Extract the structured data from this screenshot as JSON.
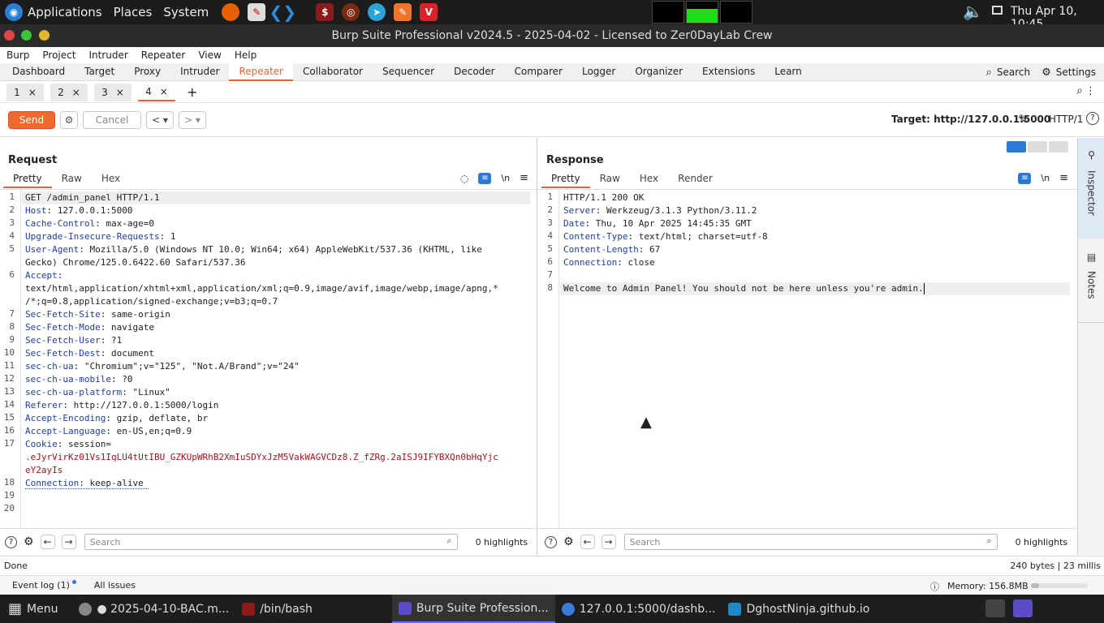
{
  "system": {
    "menus": [
      "Applications",
      "Places",
      "System"
    ],
    "clock": "Thu Apr 10, 10:45"
  },
  "window": {
    "title": "Burp Suite Professional v2024.5 - 2025-04-02 - Licensed to Zer0DayLab Crew"
  },
  "menubar": [
    "Burp",
    "Project",
    "Intruder",
    "Repeater",
    "View",
    "Help"
  ],
  "main_tabs": [
    "Dashboard",
    "Target",
    "Proxy",
    "Intruder",
    "Repeater",
    "Collaborator",
    "Sequencer",
    "Decoder",
    "Comparer",
    "Logger",
    "Organizer",
    "Extensions",
    "Learn"
  ],
  "main_tabs_right": {
    "search": "Search",
    "settings": "Settings"
  },
  "sub_tabs": [
    "1",
    "2",
    "3",
    "4"
  ],
  "toolbar": {
    "send": "Send",
    "cancel": "Cancel",
    "target_label": "Target: http://127.0.0.1:5000",
    "http_version": "HTTP/1"
  },
  "request": {
    "title": "Request",
    "tabs": [
      "Pretty",
      "Raw",
      "Hex"
    ],
    "line_numbers": [
      "1",
      "2",
      "3",
      "4",
      "5",
      "6",
      "7",
      "8",
      "9",
      "10",
      "11",
      "12",
      "13",
      "14",
      "15",
      "16",
      "17",
      "18",
      "19",
      "20"
    ],
    "lines": [
      {
        "key": "",
        "val": "GET /admin_panel HTTP/1.1"
      },
      {
        "key": "Host",
        "val": ": 127.0.0.1:5000"
      },
      {
        "key": "Cache-Control",
        "val": ": max-age=0"
      },
      {
        "key": "Upgrade-Insecure-Requests",
        "val": ": 1"
      },
      {
        "key": "User-Agent",
        "val": ": Mozilla/5.0 (Windows NT 10.0; Win64; x64) AppleWebKit/537.36 (KHTML, like"
      },
      {
        "key": "",
        "val": "Gecko) Chrome/125.0.6422.60 Safari/537.36"
      },
      {
        "key": "Accept",
        "val": ":"
      },
      {
        "key": "",
        "val": "text/html,application/xhtml+xml,application/xml;q=0.9,image/avif,image/webp,image/apng,*"
      },
      {
        "key": "",
        "val": "/*;q=0.8,application/signed-exchange;v=b3;q=0.7"
      },
      {
        "key": "Sec-Fetch-Site",
        "val": ": same-origin"
      },
      {
        "key": "Sec-Fetch-Mode",
        "val": ": navigate"
      },
      {
        "key": "Sec-Fetch-User",
        "val": ": ?1"
      },
      {
        "key": "Sec-Fetch-Dest",
        "val": ": document"
      },
      {
        "key": "sec-ch-ua",
        "val": ": \"Chromium\";v=\"125\", \"Not.A/Brand\";v=\"24\""
      },
      {
        "key": "sec-ch-ua-mobile",
        "val": ": ?0"
      },
      {
        "key": "sec-ch-ua-platform",
        "val": ": \"Linux\""
      },
      {
        "key": "Referer",
        "val": ": http://127.0.0.1:5000/login"
      },
      {
        "key": "Accept-Encoding",
        "val": ": gzip, deflate, br"
      },
      {
        "key": "Accept-Language",
        "val": ": en-US,en;q=0.9"
      },
      {
        "key": "Cookie",
        "val": ": session="
      },
      {
        "key": "",
        "val": ".eJyrVirKz01Vs1IqLU4tUtIBU_GZKUpWRhB2XmIuSDYxJzM5VakWAGVCDz8.Z_fZRg.2aISJ9IFYBXQn0bHqYjc"
      },
      {
        "key": "",
        "val": "eY2ayIs"
      },
      {
        "key": "Connection",
        "val": ": keep-alive"
      }
    ],
    "search_placeholder": "Search",
    "highlights": "0 highlights"
  },
  "response": {
    "title": "Response",
    "tabs": [
      "Pretty",
      "Raw",
      "Hex",
      "Render"
    ],
    "line_numbers": [
      "1",
      "2",
      "3",
      "4",
      "5",
      "6",
      "7",
      "8"
    ],
    "lines": [
      {
        "key": "",
        "val": "HTTP/1.1 200 OK"
      },
      {
        "key": "Server",
        "val": ": Werkzeug/3.1.3 Python/3.11.2"
      },
      {
        "key": "Date",
        "val": ": Thu, 10 Apr 2025 14:45:35 GMT"
      },
      {
        "key": "Content-Type",
        "val": ": text/html; charset=utf-8"
      },
      {
        "key": "Content-Length",
        "val": ": 67"
      },
      {
        "key": "Connection",
        "val": ": close"
      },
      {
        "key": "",
        "val": ""
      },
      {
        "key": "",
        "val": "Welcome to Admin Panel! You should not be here unless you're admin."
      }
    ],
    "search_placeholder": "Search",
    "highlights": "0 highlights"
  },
  "status": {
    "left": "Done",
    "right": "240 bytes | 23 millis"
  },
  "eventbar": {
    "event_log": "Event log (1)",
    "all_issues": "All issues",
    "memory": "Memory: 156.8MB"
  },
  "inspector": {
    "inspector": "Inspector",
    "notes": "Notes"
  },
  "taskbar": {
    "menu": "Menu",
    "tasks": [
      "● 2025-04-10-BAC.m...",
      "/bin/bash",
      "Burp Suite Profession...",
      "127.0.0.1:5000/dashb...",
      "DghostNinja.github.io"
    ]
  },
  "colors": {
    "accent": "#e8642c",
    "send": "#f06a2f",
    "header_key": "#1f3fa0",
    "cookie": "#a4151a"
  }
}
